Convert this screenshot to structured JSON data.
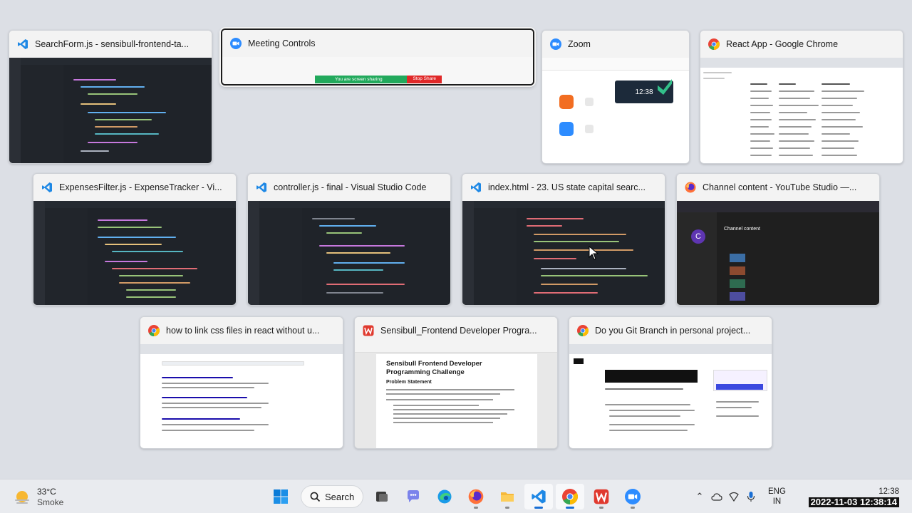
{
  "windows": [
    {
      "app": "vscode",
      "title": "SearchForm.js - sensibull-frontend-ta..."
    },
    {
      "app": "zoom",
      "title": "Meeting Controls",
      "banner_text": "You are screen sharing",
      "stop_label": "Stop Share"
    },
    {
      "app": "zoom",
      "title": "Zoom",
      "clock": "12:38"
    },
    {
      "app": "chrome",
      "title": "React App - Google Chrome"
    },
    {
      "app": "vscode",
      "title": "ExpensesFilter.js - ExpenseTracker - Vi..."
    },
    {
      "app": "vscode",
      "title": "controller.js - final - Visual Studio Code"
    },
    {
      "app": "vscode",
      "title": "index.html - 23. US state capital searc..."
    },
    {
      "app": "firefox",
      "title": "Channel content - YouTube Studio —...",
      "heading": "Channel content",
      "avatar_letter": "C"
    },
    {
      "app": "chrome",
      "title": "how to link css files in react without u..."
    },
    {
      "app": "wps",
      "title": "Sensibull_Frontend Developer Progra...",
      "doc_title": "Sensibull Frontend Developer Programming Challenge",
      "doc_section": "Problem Statement"
    },
    {
      "app": "chrome",
      "title": "Do you Git Branch in personal project..."
    }
  ],
  "taskbar": {
    "weather": {
      "temp": "33°C",
      "condition": "Smoke",
      "icon": "sun-haze-icon"
    },
    "search_label": "Search",
    "apps": [
      "windows-start-icon",
      "search-icon",
      "file-explorer-dark-icon",
      "teams-chat-icon",
      "edge-icon",
      "firefox-icon",
      "file-explorer-icon",
      "vscode-icon",
      "chrome-icon",
      "wps-office-icon",
      "zoom-icon"
    ],
    "tray": {
      "lang_top": "ENG",
      "lang_bottom": "IN"
    },
    "clock": {
      "time": "12:38",
      "date": "2022-11-03 12:38:14"
    }
  },
  "colors": {
    "vscode": "#1e88e5",
    "zoom": "#2d8cff",
    "chrome_red": "#ea4335",
    "accent": "#1a6fd4"
  }
}
